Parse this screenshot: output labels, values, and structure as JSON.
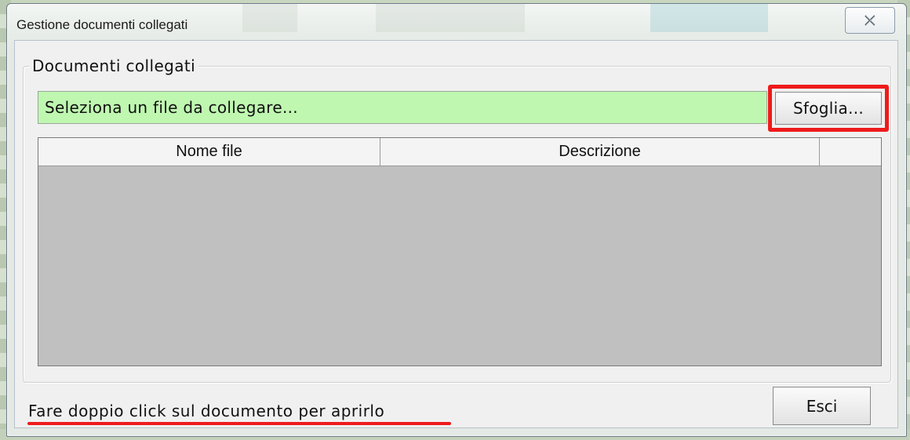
{
  "window": {
    "title": "Gestione documenti collegati"
  },
  "group": {
    "label": "Documenti collegati"
  },
  "file_selector": {
    "value": "Seleziona un file da collegare...",
    "browse_label": "Sfoglia...",
    "highlight_color": "#ee1b1b",
    "field_color": "#bff7b0"
  },
  "table": {
    "columns": [
      "Nome file",
      "Descrizione",
      ""
    ],
    "rows": []
  },
  "footer": {
    "hint": "Fare doppio click sul documento per aprirlo",
    "exit_label": "Esci"
  }
}
